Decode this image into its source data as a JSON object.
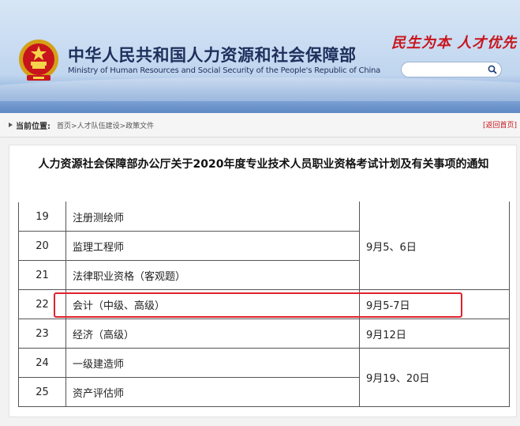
{
  "header": {
    "title_cn": "中华人民共和国人力资源和社会保障部",
    "title_en": "Ministry of Human Resources and Social Security of the People's Republic of China",
    "slogan": "民生为本 人才优先",
    "search_placeholder": "",
    "emblem_icon": "national-emblem-icon",
    "accent_color": "#c8141c",
    "title_color": "#1f2f5c"
  },
  "breadcrumb": {
    "label": "当前位置:",
    "items": [
      "首页",
      "人才队伍建设",
      "政策文件"
    ],
    "separator": ">",
    "back_label": "[返回首页]"
  },
  "document": {
    "title": "人力资源社会保障部办公厅关于2020年度专业技术人员职业资格考试计划及有关事项的通知"
  },
  "table": {
    "rows": [
      {
        "num": "19",
        "name": "注册测绘师"
      },
      {
        "num": "20",
        "name": "监理工程师"
      },
      {
        "num": "21",
        "name": "法律职业资格（客观题）"
      },
      {
        "num": "22",
        "name": "会计（中级、高级）"
      },
      {
        "num": "23",
        "name": "经济（高级）"
      },
      {
        "num": "24",
        "name": "一级建造师"
      },
      {
        "num": "25",
        "name": "资产评估师"
      }
    ],
    "dates": [
      {
        "label": "9月5、6日",
        "rowspan": 3
      },
      {
        "label": "9月5-7日",
        "rowspan": 1
      },
      {
        "label": "9月12日",
        "rowspan": 1
      },
      {
        "label": "9月19、20日",
        "rowspan": 2
      }
    ],
    "highlight_row": "22",
    "highlight_color": "#e0212b"
  }
}
